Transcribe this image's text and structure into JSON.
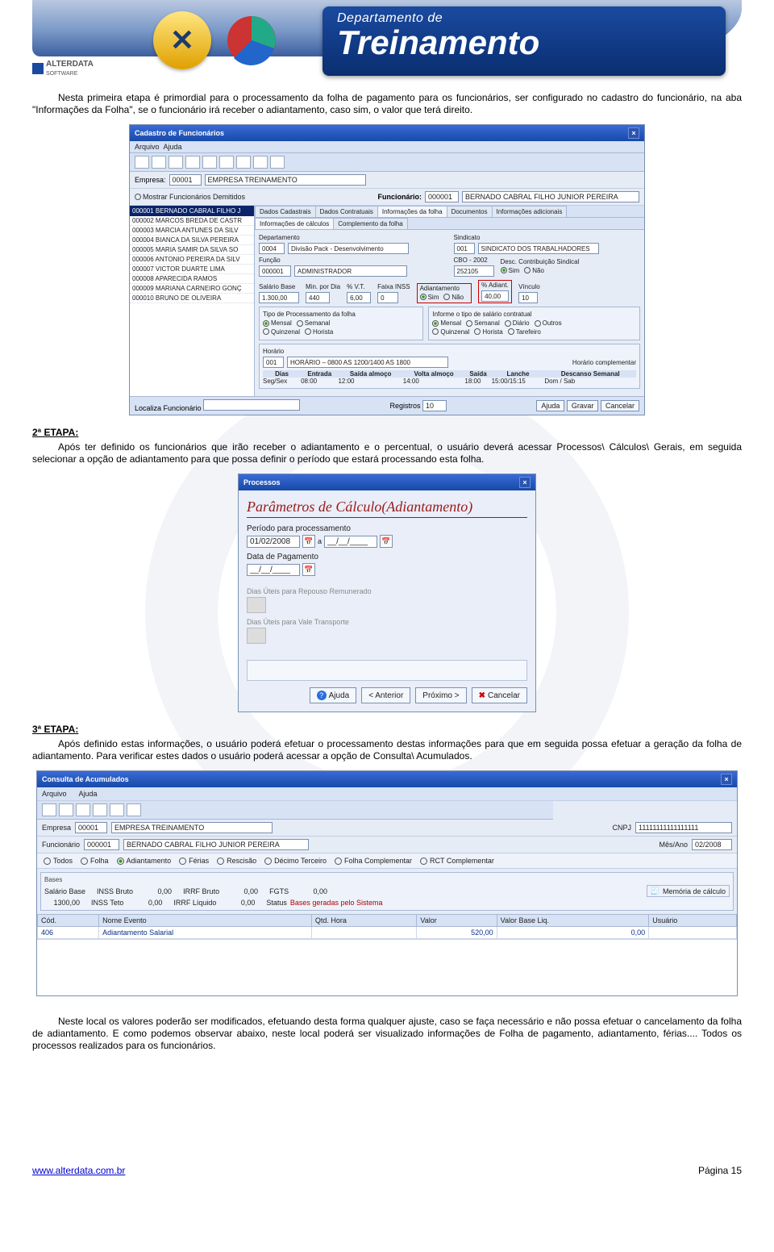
{
  "header": {
    "dept": "Departamento de",
    "trein": "Treinamento",
    "small_logo": "ALTERDATA",
    "small_logo2": "SOFTWARE"
  },
  "para1": "Nesta primeira etapa é primordial para o processamento da folha de pagamento para os funcionários, ser configurado no cadastro do funcionário, na aba \"Informações da Folha\", se o funcionário irá receber o adiantamento, caso sim, o valor que terá direito.",
  "etapa2_h": "2ª ETAPA:",
  "etapa2_p": "Após ter definido os funcionários que irão receber o adiantamento e o percentual, o usuário deverá acessar Processos\\ Cálculos\\ Gerais, em seguida selecionar a opção de adiantamento para que possa definir o período que estará processando esta folha.",
  "etapa3_h": "3ª ETAPA:",
  "etapa3_p": "Após definido estas informações, o usuário poderá efetuar o processamento destas informações para que em seguida possa efetuar a geração da folha de adiantamento. Para verificar estes dados o usuário poderá acessar a opção de Consulta\\ Acumulados.",
  "para_last": "Neste local os valores poderão ser modificados, efetuando desta forma qualquer ajuste, caso se faça necessário e não possa efetuar o cancelamento da folha de adiantamento. E como podemos observar abaixo, neste local poderá ser visualizado informações de Folha de pagamento, adiantamento, férias.... Todos os processos realizados para os funcionários.",
  "footer_url": "www.alterdata.com.br",
  "footer_page": "Página 15",
  "cad": {
    "title": "Cadastro de Funcionários",
    "menu_arquivo": "Arquivo",
    "menu_ajuda": "Ajuda",
    "empresa_lbl": "Empresa:",
    "empresa_cod": "00001",
    "empresa_nome": "EMPRESA TREINAMENTO",
    "mostrar_dem": "Mostrar Funcionários Demitidos",
    "func_lbl": "Funcionário:",
    "func_cod": "000001",
    "func_nome": "BERNADO CABRAL FILHO JUNIOR PEREIRA",
    "list": [
      "000001  BERNADO CABRAL FILHO J",
      "000002  MARCOS BREDA DE CASTR",
      "000003  MARCIA ANTUNES DA SILV",
      "000004  BIANCA DA SILVA PEREIRA",
      "000005  MARIA SAMIR DA SILVA SO",
      "000006  ANTONIO PEREIRA DA SILV",
      "000007  VICTOR DUARTE LIMA",
      "000008  APARECIDA RAMOS",
      "000009  MARIANA CARNEIRO GONÇ",
      "000010  BRUNO DE OLIVEIRA"
    ],
    "tab1": "Dados Cadastrais",
    "tab2": "Dados Contratuais",
    "tab3": "Informações da folha",
    "tab4": "Documentos",
    "tab5": "Informações adicionais",
    "subtab1": "Informações de cálculos",
    "subtab2": "Complemento da folha",
    "dep_lbl": "Departamento",
    "dep_cod": "0004",
    "dep_nome": "Divisão Pack - Desenvolvimento",
    "sind_lbl": "Sindicato",
    "sind_cod": "001",
    "sind_nome": "SINDICATO DOS TRABALHADORES",
    "cbo_lbl": "CBO - 2002",
    "cbo_val": "252105",
    "desc_sind_lbl": "Desc. Contribuição Sindical",
    "func_lbl2": "Função",
    "func_cod2": "000001",
    "func_nome2": "ADMINISTRADOR",
    "sim": "Sim",
    "nao": "Não",
    "sal_lbl": "Salário Base",
    "sal_val": "1.300,00",
    "min_lbl": "Min. por Dia",
    "min_val": "440",
    "vt_lbl": "% V.T.",
    "vt_val": "6,00",
    "inss_lbl": "Faixa INSS",
    "inss_val": "0",
    "adi_lbl": "Adiantamento",
    "pct_lbl": "% Adiant.",
    "pct_val": "40,00",
    "vin_lbl": "Vínculo",
    "vin_val": "10",
    "tipo_proc": "Tipo de Processamento da folha",
    "tipo_sal": "Informe o tipo de salário contratual",
    "mensal": "Mensal",
    "semanal": "Semanal",
    "quinzenal": "Quinzenal",
    "horista": "Horista",
    "diario": "Diário",
    "tarefeiro": "Tarefeiro",
    "outros": "Outros",
    "hor_lbl": "Horário",
    "hor_cod": "001",
    "hor_nome": "HORÁRIO – 0800 AS 1200/1400 AS 1800",
    "hor_comp": "Horário complementar",
    "hdr_dias": "Dias",
    "hdr_ent": "Entrada",
    "hdr_sa": "Saída almoço",
    "hdr_va": "Volta almoço",
    "hdr_sai": "Saída",
    "hdr_lan": "Lanche",
    "hdr_ds": "Descanso Semanal",
    "dias_v": "Seg/Sex",
    "ent_v": "08:00",
    "sa_v": "12:00",
    "va_v": "14:00",
    "sai_v": "18:00",
    "lan_v": "15:00/15:15",
    "ds_v": "Dom / Sab",
    "loc_lbl": "Localiza Funcionário",
    "reg_lbl": "Registros",
    "reg_val": "10",
    "btn_ajuda": "Ajuda",
    "btn_gravar": "Gravar",
    "btn_cancelar": "Cancelar"
  },
  "proc": {
    "title": "Processos",
    "h2": "Parâmetros de Cálculo(Adiantamento)",
    "periodo_lbl": "Período para processamento",
    "date1": "01/02/2008",
    "date_a": "a",
    "date2": "__/__/____",
    "pag_lbl": "Data de Pagamento",
    "pag_v": "__/__/____",
    "d1": "Dias Úteis para Repouso Remunerado",
    "d2": "Dias Úteis para Vale Transporte",
    "btn_ajuda": "Ajuda",
    "btn_ant": "< Anterior",
    "btn_prox": "Próximo >",
    "btn_canc": "Cancelar"
  },
  "cons": {
    "title": "Consulta de Acumulados",
    "menu_arquivo": "Arquivo",
    "menu_ajuda": "Ajuda",
    "emp_lbl": "Empresa",
    "emp_cod": "00001",
    "emp_nome": "EMPRESA TREINAMENTO",
    "cnpj_lbl": "CNPJ",
    "cnpj_v": "11111111111111111",
    "func_lbl": "Funcionário",
    "func_cod": "000001",
    "func_nome": "BERNADO CABRAL FILHO JUNIOR PEREIRA",
    "mes_lbl": "Mês/Ano",
    "mes_v": "02/2008",
    "r_todos": "Todos",
    "r_folha": "Folha",
    "r_adi": "Adiantamento",
    "r_fer": "Férias",
    "r_resc": "Rescisão",
    "r_dec": "Décimo Terceiro",
    "r_fc": "Folha Complementar",
    "r_rct": "RCT Complementar",
    "bases_lbl": "Bases",
    "sal_lbl": "Salário Base",
    "sal_v": "1300,00",
    "ib_lbl": "INSS Bruto",
    "ib_v": "0,00",
    "irb_lbl": "IRRF Bruto",
    "irb_v": "0,00",
    "fgts_lbl": "FGTS",
    "fgts_v": "0,00",
    "it_lbl": "INSS Teto",
    "it_v": "0,00",
    "irl_lbl": "IRRF Líquido",
    "irl_v": "0,00",
    "status_lbl": "Status",
    "status_v": "Bases geradas pelo Sistema",
    "mem": "Memória de cálculo",
    "th_cod": "Cód.",
    "th_nome": "Nome Evento",
    "th_qtd": "Qtd. Hora",
    "th_valor": "Valor",
    "th_base": "Valor Base Liq.",
    "th_usr": "Usuário",
    "td_cod": "406",
    "td_nome": "Adiantamento Salarial",
    "td_valor": "520,00",
    "td_base": "0,00"
  }
}
